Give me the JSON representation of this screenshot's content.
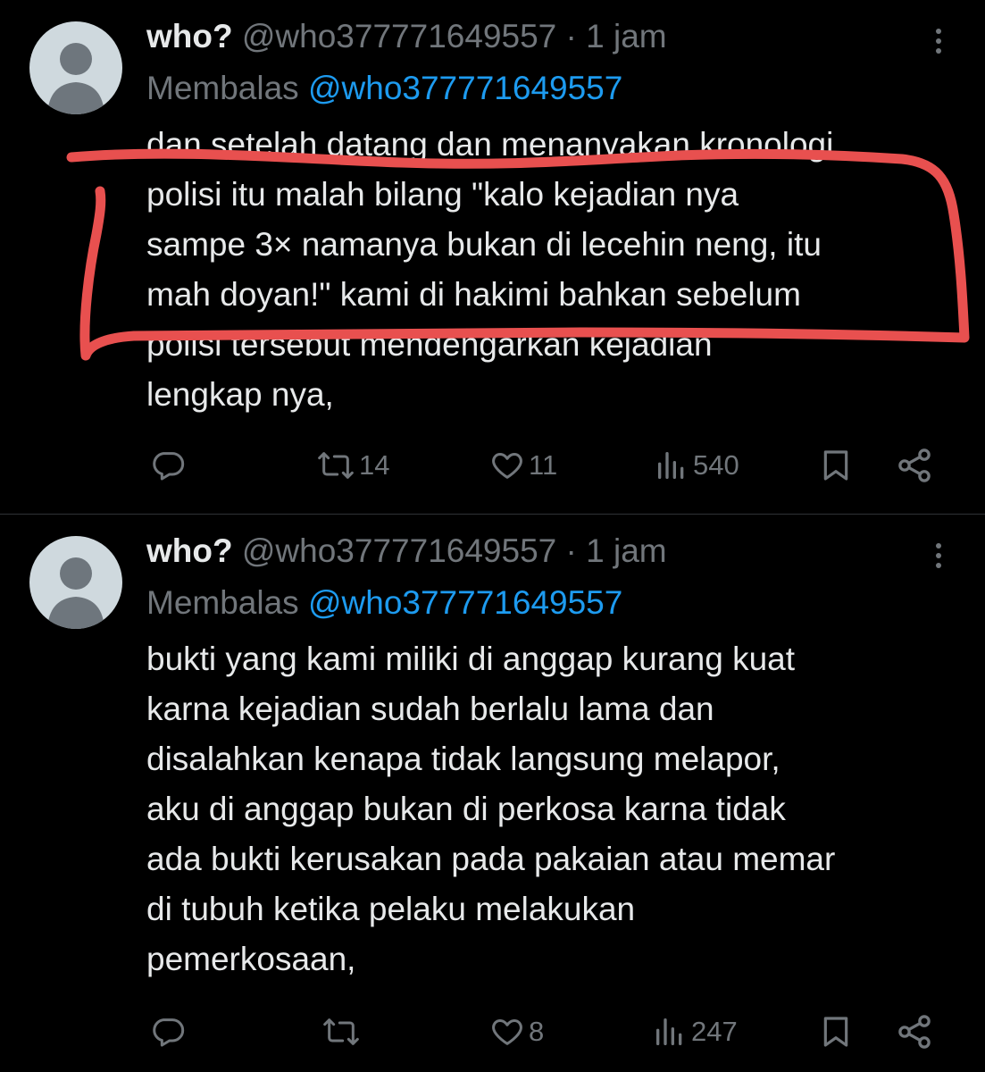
{
  "tweets": [
    {
      "author_name": "who?",
      "handle": "@who377771649557",
      "separator": "·",
      "time": "1 jam",
      "reply_label": "Membalas",
      "reply_to": "@who377771649557",
      "lines": [
        "dan setelah datang dan menanyakan kronologi",
        "polisi itu malah bilang \"kalo kejadian nya",
        "sampe 3× namanya bukan di lecehin neng, itu",
        "mah doyan!\" kami di hakimi bahkan sebelum",
        "polisi tersebut mendengarkan kejadian",
        "lengkap nya,"
      ],
      "stats": {
        "retweets": "14",
        "likes": "11",
        "views": "540"
      }
    },
    {
      "author_name": "who?",
      "handle": "@who377771649557",
      "separator": "·",
      "time": "1 jam",
      "reply_label": "Membalas",
      "reply_to": "@who377771649557",
      "lines": [
        "bukti yang kami miliki di anggap kurang kuat",
        "karna kejadian sudah berlalu lama dan",
        "disalahkan kenapa tidak langsung melapor,",
        "aku di anggap bukan di perkosa karna tidak",
        "ada bukti kerusakan pada pakaian atau memar",
        "di tubuh ketika pelaku melakukan",
        "pemerkosaan,"
      ],
      "stats": {
        "retweets": "",
        "likes": "8",
        "views": "247"
      }
    }
  ],
  "annotation_color": "#e8504f",
  "icons": [
    "avatar-placeholder",
    "more-icon",
    "reply-icon",
    "retweet-icon",
    "like-icon",
    "views-icon",
    "bookmark-icon",
    "share-icon"
  ]
}
